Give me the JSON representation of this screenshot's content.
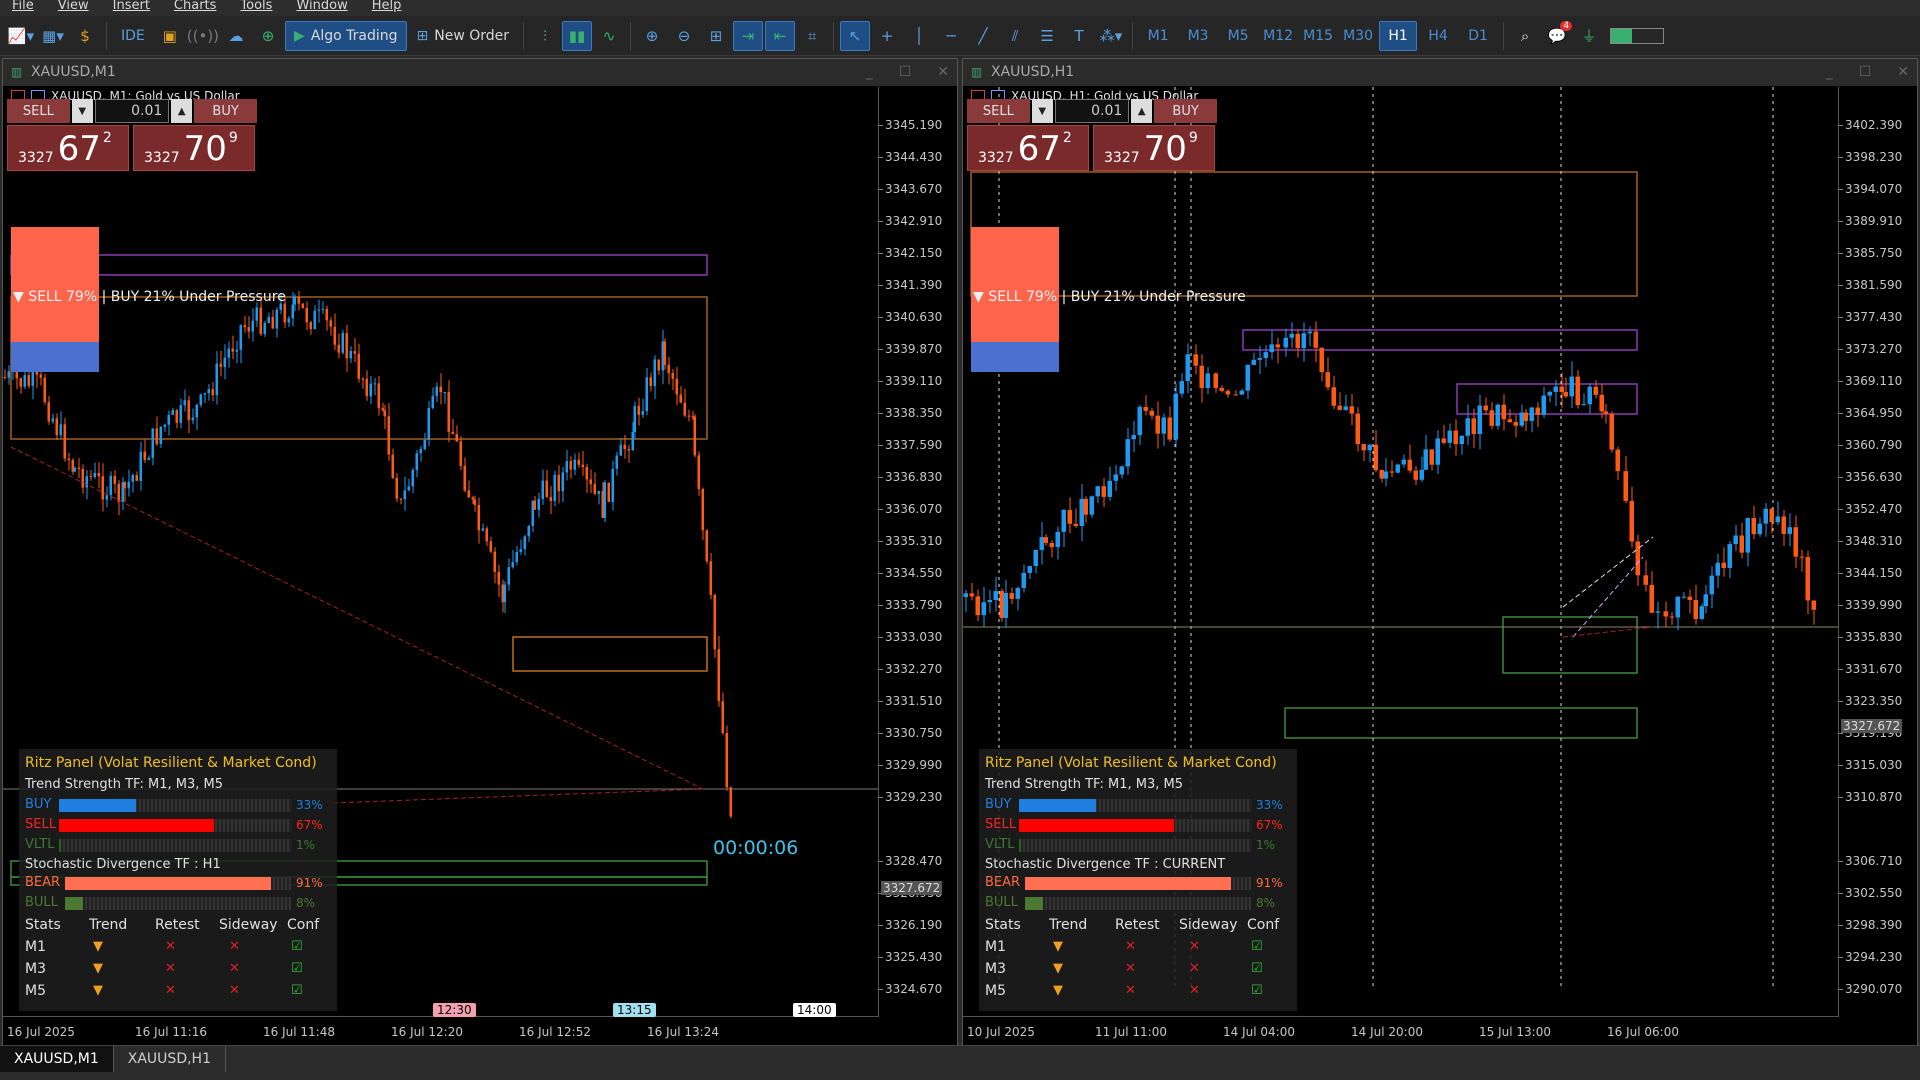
{
  "menu": [
    "File",
    "View",
    "Insert",
    "Charts",
    "Tools",
    "Window",
    "Help"
  ],
  "toolbar": {
    "ide_label": "IDE",
    "algo_label": "Algo Trading",
    "new_order_label": "New Order",
    "timeframes": [
      "M1",
      "M3",
      "M5",
      "M12",
      "M15",
      "M30",
      "H1",
      "H4",
      "D1"
    ],
    "active_timeframe": "H1",
    "notification_count": "4"
  },
  "windows": [
    {
      "title": "XAUUSD,M1",
      "chart_label": "XAUUSD, M1:  Gold vs US Dollar",
      "sell_label": "SELL",
      "buy_label": "BUY",
      "lot": "0.01",
      "sell_price": {
        "prefix": "3327",
        "big": "67",
        "sup": "2"
      },
      "buy_price": {
        "prefix": "3327",
        "big": "70",
        "sup": "9"
      },
      "pressure": "▼ SELL 79% | BUY 21% Under Pressure",
      "countdown": "00:00:06",
      "current_price": "3327.672",
      "price_ticks": [
        "3345.190",
        "3344.430",
        "3343.670",
        "3342.910",
        "3342.150",
        "3341.390",
        "3340.630",
        "3339.870",
        "3339.110",
        "3338.350",
        "3337.590",
        "3336.830",
        "3336.070",
        "3335.310",
        "3334.550",
        "3333.790",
        "3333.030",
        "3332.270",
        "3331.510",
        "3330.750",
        "3329.990",
        "3329.230",
        "3328.470",
        "3326.950",
        "3326.190",
        "3325.430",
        "3324.670"
      ],
      "time_ticks": [
        "16 Jul 2025",
        "16 Jul 11:16",
        "16 Jul 11:48",
        "16 Jul 12:20",
        "16 Jul 12:52",
        "16 Jul 13:24"
      ],
      "time_markers": [
        "12:30",
        "13:15",
        "14:00"
      ],
      "ritz": {
        "title": "Ritz Panel (Volat Resilient & Market Cond)",
        "trend_title": "Trend Strength TF: M1, M3, M5",
        "buy": {
          "label": "BUY",
          "pct": "33%",
          "value": 0.33
        },
        "sell": {
          "label": "SELL",
          "pct": "67%",
          "value": 0.67
        },
        "vltl": {
          "label": "VLTL",
          "pct": "1%",
          "value": 0.01
        },
        "stoch_title": "Stochastic Divergence TF : H1",
        "bear": {
          "label": "BEAR",
          "pct": "91%",
          "value": 0.91
        },
        "bull": {
          "label": "BULL",
          "pct": "8%",
          "value": 0.08
        },
        "headers": [
          "Stats",
          "Trend",
          "Retest",
          "Sideway",
          "Conf"
        ],
        "rows": [
          "M1",
          "M3",
          "M5"
        ]
      }
    },
    {
      "title": "XAUUSD,H1",
      "chart_label": "XAUUSD, H1:  Gold vs US Dollar",
      "sell_label": "SELL",
      "buy_label": "BUY",
      "lot": "0.01",
      "sell_price": {
        "prefix": "3327",
        "big": "67",
        "sup": "2"
      },
      "buy_price": {
        "prefix": "3327",
        "big": "70",
        "sup": "9"
      },
      "pressure": "▼ SELL 79% | BUY 21% Under Pressure",
      "current_price": "3327.672",
      "price_ticks": [
        "3402.390",
        "3398.230",
        "3394.070",
        "3389.910",
        "3385.750",
        "3381.590",
        "3377.430",
        "3373.270",
        "3369.110",
        "3364.950",
        "3360.790",
        "3356.630",
        "3352.470",
        "3348.310",
        "3344.150",
        "3339.990",
        "3335.830",
        "3331.670",
        "3323.350",
        "3319.190",
        "3315.030",
        "3310.870",
        "3306.710",
        "3302.550",
        "3298.390",
        "3294.230",
        "3290.070"
      ],
      "time_ticks": [
        "10 Jul 2025",
        "11 Jul 11:00",
        "14 Jul 04:00",
        "14 Jul 20:00",
        "15 Jul 13:00",
        "16 Jul 06:00"
      ],
      "ritz": {
        "title": "Ritz Panel (Volat Resilient & Market Cond)",
        "trend_title": "Trend Strength TF: M1, M3, M5",
        "buy": {
          "label": "BUY",
          "pct": "33%",
          "value": 0.33
        },
        "sell": {
          "label": "SELL",
          "pct": "67%",
          "value": 0.67
        },
        "vltl": {
          "label": "VLTL",
          "pct": "1%",
          "value": 0.01
        },
        "stoch_title": "Stochastic Divergence TF : CURRENT",
        "bear": {
          "label": "BEAR",
          "pct": "91%",
          "value": 0.91
        },
        "bull": {
          "label": "BULL",
          "pct": "8%",
          "value": 0.08
        },
        "headers": [
          "Stats",
          "Trend",
          "Retest",
          "Sideway",
          "Conf"
        ],
        "rows": [
          "M1",
          "M3",
          "M5"
        ]
      }
    }
  ],
  "tabs": [
    "XAUUSD,M1",
    "XAUUSD,H1"
  ],
  "colors": {
    "bull": "#1e9bf0",
    "bear": "#ff5a14",
    "accent": "#1f4e85"
  }
}
